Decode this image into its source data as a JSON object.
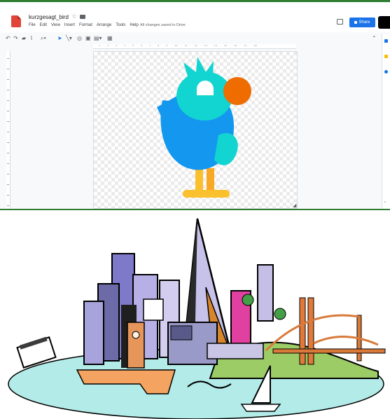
{
  "document": {
    "title": "kurzgesagt_bird",
    "save_status": "All changes saved in Drive"
  },
  "menu": [
    "File",
    "Edit",
    "View",
    "Insert",
    "Format",
    "Arrange",
    "Tools",
    "Help"
  ],
  "actions": {
    "share_label": "Share"
  },
  "toolbar": {
    "icons": [
      "undo-icon",
      "redo-icon",
      "print-icon",
      "paint-format-icon",
      "zoom-icon",
      "select-icon",
      "line-icon",
      "shape-icon",
      "image-icon",
      "text-box-icon",
      "comment-add-icon"
    ]
  },
  "colors": {
    "accent_blue": "#1a73e8",
    "bird_cyan": "#12d4d0",
    "bird_blue": "#1397ef",
    "bird_beak": "#ef6c00",
    "bird_feet": "#fbc02d",
    "window_frame": "#2e7d32"
  }
}
